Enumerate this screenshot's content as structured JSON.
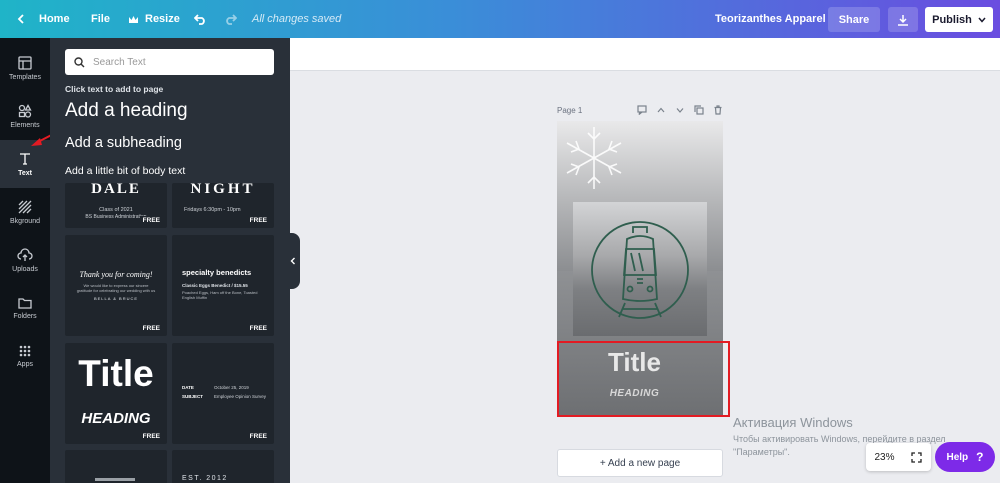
{
  "topbar": {
    "home_label": "Home",
    "file_label": "File",
    "resize_label": "Resize",
    "saved_status": "All changes saved",
    "brand_name": "Teorizanthes Apparel",
    "share_label": "Share",
    "publish_label": "Publish"
  },
  "rail": {
    "items": [
      {
        "label": "Templates",
        "icon": "templates-icon"
      },
      {
        "label": "Elements",
        "icon": "elements-icon"
      },
      {
        "label": "Text",
        "icon": "text-icon"
      },
      {
        "label": "Bkground",
        "icon": "background-icon"
      },
      {
        "label": "Uploads",
        "icon": "uploads-icon"
      },
      {
        "label": "Folders",
        "icon": "folders-icon"
      },
      {
        "label": "Apps",
        "icon": "apps-icon"
      }
    ]
  },
  "text_panel": {
    "search_placeholder": "Search Text",
    "hint": "Click text to add to page",
    "add_heading": "Add a heading",
    "add_subheading": "Add a subheading",
    "add_body": "Add a little bit of body text",
    "templates": [
      {
        "main": "DALE",
        "sub1": "Class of 2021",
        "sub2": "BS Business Administration",
        "badge": "FREE"
      },
      {
        "main": "NIGHT",
        "sub1": "Fridays 6:30pm - 10pm",
        "badge": "FREE"
      },
      {
        "main": "Thank you for coming!",
        "sub1": "We would like to express our sincere",
        "sub2": "gratitude for celebrating our wedding with us",
        "sub3": "BELLA & BRUCE",
        "badge": "FREE"
      },
      {
        "main": "specialty benedicts",
        "sub1": "Classic Eggs Benedict / $15.55",
        "sub2": "Poached Eggs, Ham off the Bone, Toasted",
        "sub3": "English Muffin",
        "badge": "FREE"
      },
      {
        "main": "Title",
        "sub1": "HEADING",
        "badge": "FREE"
      },
      {
        "row1_label": "DATE",
        "row1_value": "October 25, 2019",
        "row2_label": "SUBJECT",
        "row2_value": "Employee Opinion Survey",
        "badge": "FREE"
      },
      {
        "main": "EST. 2012"
      }
    ]
  },
  "page": {
    "label": "Page 1",
    "title_text": "Title",
    "heading_text": "HEADING",
    "add_page_label": "+ Add a new page"
  },
  "activation": {
    "title": "Активация Windows",
    "line1": "Чтобы активировать Windows, перейдите в раздел",
    "line2": "\"Параметры\"."
  },
  "zoom": {
    "level": "23%"
  },
  "help": {
    "label": "Help",
    "icon_glyph": "?"
  },
  "colors": {
    "accent": "#7d2ae8",
    "panel_bg": "#293039",
    "rail_bg": "#0e1318",
    "selection": "#e31b23",
    "illustration": "#2f5e4e"
  }
}
